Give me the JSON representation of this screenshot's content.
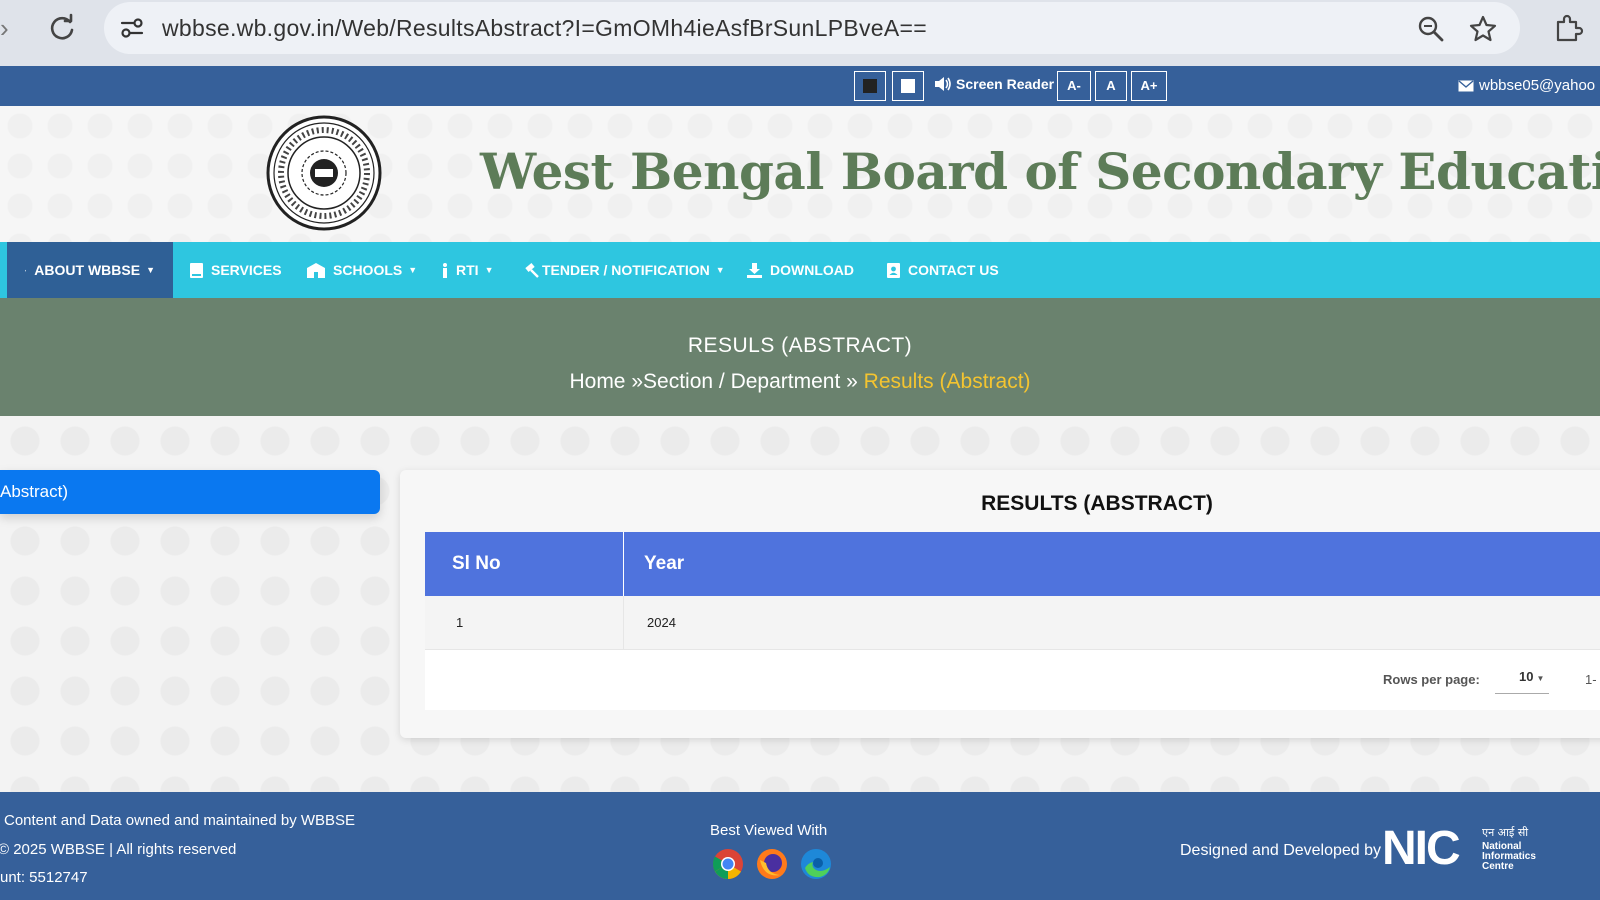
{
  "browser": {
    "url": "wbbse.wb.gov.in/Web/ResultsAbstract?I=GmOMh4ieAsfBrSunLPBveA=="
  },
  "accessibility": {
    "screen_reader_label": "Screen Reader",
    "font_decrease": "A-",
    "font_normal": "A",
    "font_increase": "A+",
    "email": "wbbse05@yahoo"
  },
  "header": {
    "title": "West Bengal Board of Secondary Education"
  },
  "nav": {
    "items": [
      {
        "label": "ABOUT WBBSE",
        "icon": "user-icon",
        "has_dropdown": true
      },
      {
        "label": "SERVICES",
        "icon": "book-icon",
        "has_dropdown": false
      },
      {
        "label": "SCHOOLS",
        "icon": "school-icon",
        "has_dropdown": true
      },
      {
        "label": "RTI",
        "icon": "info-icon",
        "has_dropdown": true
      },
      {
        "label": "TENDER / NOTIFICATION",
        "icon": "gavel-icon",
        "has_dropdown": true
      },
      {
        "label": "DOWNLOAD",
        "icon": "download-icon",
        "has_dropdown": false
      },
      {
        "label": "CONTACT US",
        "icon": "contact-icon",
        "has_dropdown": false
      }
    ]
  },
  "banner": {
    "title": "RESULS (ABSTRACT)",
    "breadcrumb_home": "Home",
    "breadcrumb_section": "Section / Department",
    "breadcrumb_current": "Results (Abstract)"
  },
  "sidebar": {
    "active_item": "Abstract)"
  },
  "main": {
    "card_title": "RESULTS (ABSTRACT)",
    "table": {
      "columns": [
        "Sl No",
        "Year"
      ],
      "rows": [
        {
          "sl_no": "1",
          "year": "2024"
        }
      ]
    },
    "pagination": {
      "rows_per_page_label": "Rows per page:",
      "rows_per_page_value": "10",
      "range": "1-"
    }
  },
  "footer": {
    "line1": "Content and Data owned and maintained by WBBSE",
    "line2": "© 2025 WBBSE | All rights reserved",
    "line3": "unt: 5512747",
    "best_viewed": "Best Viewed With",
    "designed_by": "Designed and Developed by"
  },
  "colors": {
    "accessibility_bar": "#36609a",
    "nav_bar": "#2ec6e0",
    "nav_active": "#2f6096",
    "banner": "#6a826e",
    "title_green": "#5d7c58",
    "table_header": "#4f73dd",
    "sidebar_active": "#0a78f0",
    "breadcrumb_current": "#f4c430"
  }
}
